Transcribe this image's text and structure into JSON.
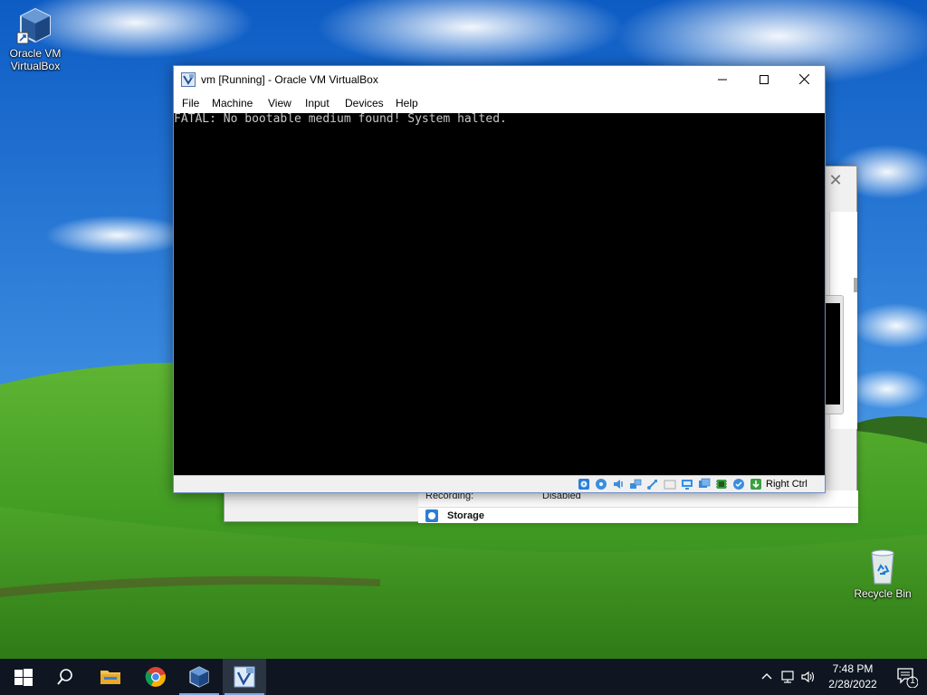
{
  "desktop": {
    "icons": [
      {
        "label_line1": "Oracle VM",
        "label_line2": "VirtualBox"
      },
      {
        "label_line1": "Recycle Bin"
      }
    ]
  },
  "vm_window": {
    "title": "vm [Running] - Oracle VM VirtualBox",
    "caption": {
      "minimize": "—",
      "maximize": "☐",
      "close": "✕"
    },
    "menu": [
      "File",
      "Machine",
      "View",
      "Input",
      "Devices",
      "Help"
    ],
    "console_text": "FATAL: No bootable medium found! System halted.",
    "status_icons": [
      "hard-disk-icon",
      "optical-drive-icon",
      "audio-icon",
      "network-icon",
      "usb-icon",
      "shared-folders-icon",
      "display-icon",
      "video-capture-icon",
      "cpu-icon",
      "mouse-integration-icon",
      "keyboard-capture-icon"
    ],
    "host_key": "Right Ctrl"
  },
  "manager_window": {
    "recording_label": "Recording:",
    "recording_value": "Disabled",
    "storage_title": "Storage"
  },
  "taskbar": {
    "items": [
      "start-button",
      "search-button",
      "file-explorer",
      "chrome",
      "virtualbox-manager",
      "virtualbox-vm"
    ],
    "time": "7:48 PM",
    "date": "2/28/2022",
    "notification_count": "1"
  },
  "colors": {
    "taskbar": "#0f1621",
    "vm_screen": "#000000",
    "console_text": "#c7c7c7",
    "accent": "#7aa8e6"
  }
}
